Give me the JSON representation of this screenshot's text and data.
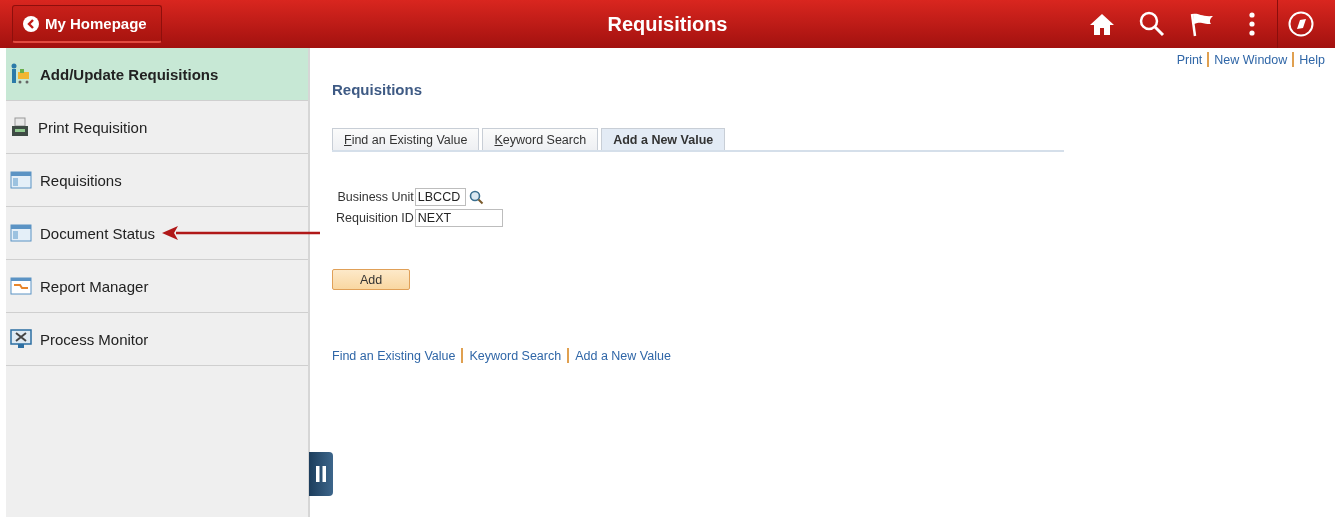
{
  "header": {
    "back_button": "My Homepage",
    "title": "Requisitions"
  },
  "sidebar": {
    "items": [
      {
        "label": "Add/Update Requisitions",
        "kind": "cart",
        "selected": true,
        "annotated": false
      },
      {
        "label": "Print Requisition",
        "kind": "print",
        "selected": false,
        "annotated": false
      },
      {
        "label": "Requisitions",
        "kind": "page",
        "selected": false,
        "annotated": false
      },
      {
        "label": "Document Status",
        "kind": "page",
        "selected": false,
        "annotated": true
      },
      {
        "label": "Report Manager",
        "kind": "report",
        "selected": false,
        "annotated": false
      },
      {
        "label": "Process Monitor",
        "kind": "monitor",
        "selected": false,
        "annotated": false
      }
    ]
  },
  "top_links": [
    "Print",
    "New Window",
    "Help"
  ],
  "page_title": "Requisitions",
  "tabs": [
    {
      "label": "Find an Existing Value",
      "selected": false,
      "access_key_underlined": true
    },
    {
      "label": "Keyword Search",
      "selected": false,
      "access_key_underlined": true
    },
    {
      "label": "Add a New Value",
      "selected": true,
      "access_key_underlined": false
    }
  ],
  "fields": [
    {
      "label": "Business Unit",
      "value": "LBCCD",
      "lookup": true
    },
    {
      "label": "Requisition ID",
      "value": "NEXT",
      "lookup": false
    }
  ],
  "add_button": "Add",
  "bottom_links": [
    "Find an Existing Value",
    "Keyword Search",
    "Add a New Value"
  ]
}
